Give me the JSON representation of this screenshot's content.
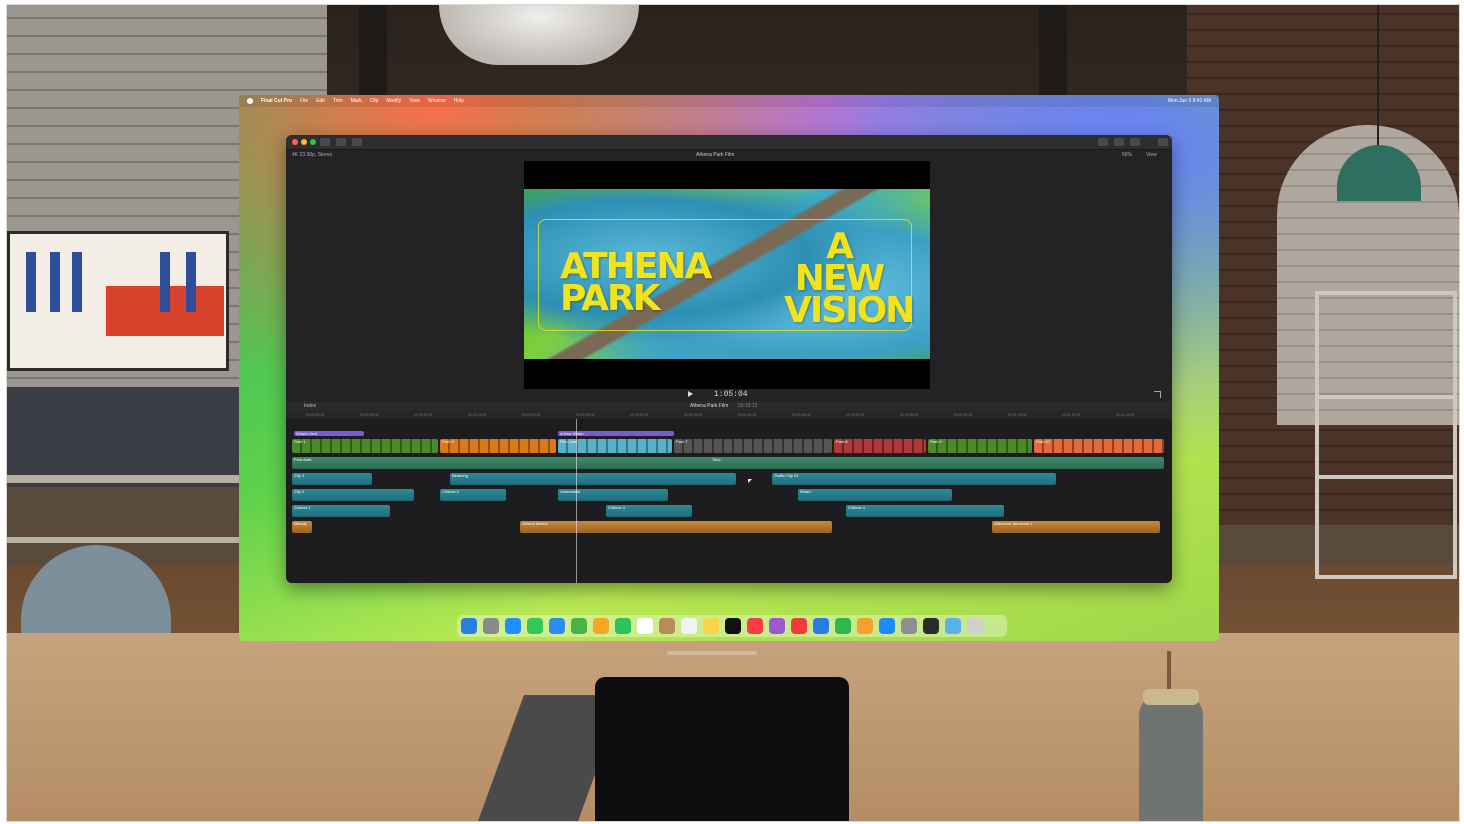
{
  "menubar": {
    "app": "Final Cut Pro",
    "items": [
      "File",
      "Edit",
      "Trim",
      "Mark",
      "Clip",
      "Modify",
      "View",
      "Window",
      "Help"
    ],
    "clock": "Mon Jun 5 9:41 AM"
  },
  "infobar": {
    "format": "4K 23.98p, Stereo",
    "project": "Athena Park Film",
    "zoom": "56%",
    "view": "View"
  },
  "viewer": {
    "title_left": "ATHENA PARK",
    "title_right": "A NEW VISION"
  },
  "transport": {
    "timecode": "1:05:04"
  },
  "timeline": {
    "index": "Index",
    "project": "Athena Park Film",
    "duration": "03:18:12",
    "ruler": [
      "00:00:00:00",
      "00:00:05:00",
      "00:00:10:00",
      "00:00:15:00",
      "00:00:20:00",
      "00:00:25:00",
      "00:00:30:00",
      "00:00:35:00",
      "00:00:40:00",
      "00:00:45:00",
      "00:00:50:00",
      "00:00:55:00",
      "00:01:00:00",
      "00:01:05:00",
      "00:01:10:00",
      "00:01:15:00"
    ],
    "titles": [
      "What's Next",
      "A New Vision"
    ],
    "video_clips": [
      "Park 1",
      "Park 3",
      "Park 6",
      "Film Card",
      "Park 7",
      "Park 8",
      "Park 9",
      "Park 10"
    ],
    "audio_main": [
      "Park Amb",
      "Tone"
    ],
    "audio_clips": [
      "City 1",
      "Birdsong",
      "Traffic City 01",
      "City 2",
      "Chimes 2",
      "Underwater",
      "Wharf",
      "Chimes 1",
      "Chimes 3",
      "Chimes 4"
    ],
    "music": [
      "Melody",
      "Athena Motion",
      "Afternoon Sunshine 2"
    ]
  },
  "colors": {
    "title_yellow": "#f2e31a",
    "purple": "#7a5bd6",
    "teal": "#2f8a9a",
    "orange": "#c78a3a"
  },
  "dock_icons": [
    "finder-icon",
    "launchpad-icon",
    "safari-icon",
    "messages-icon",
    "mail-icon",
    "maps-icon",
    "photos-icon",
    "facetime-icon",
    "calendar-icon",
    "contacts-icon",
    "reminders-icon",
    "notes-icon",
    "appletv-icon",
    "music-icon",
    "podcasts-icon",
    "news-icon",
    "keynote-icon",
    "numbers-icon",
    "pages-icon",
    "appstore-icon",
    "settings-icon",
    "finalcut-icon",
    "folder-icon",
    "trash-icon"
  ]
}
